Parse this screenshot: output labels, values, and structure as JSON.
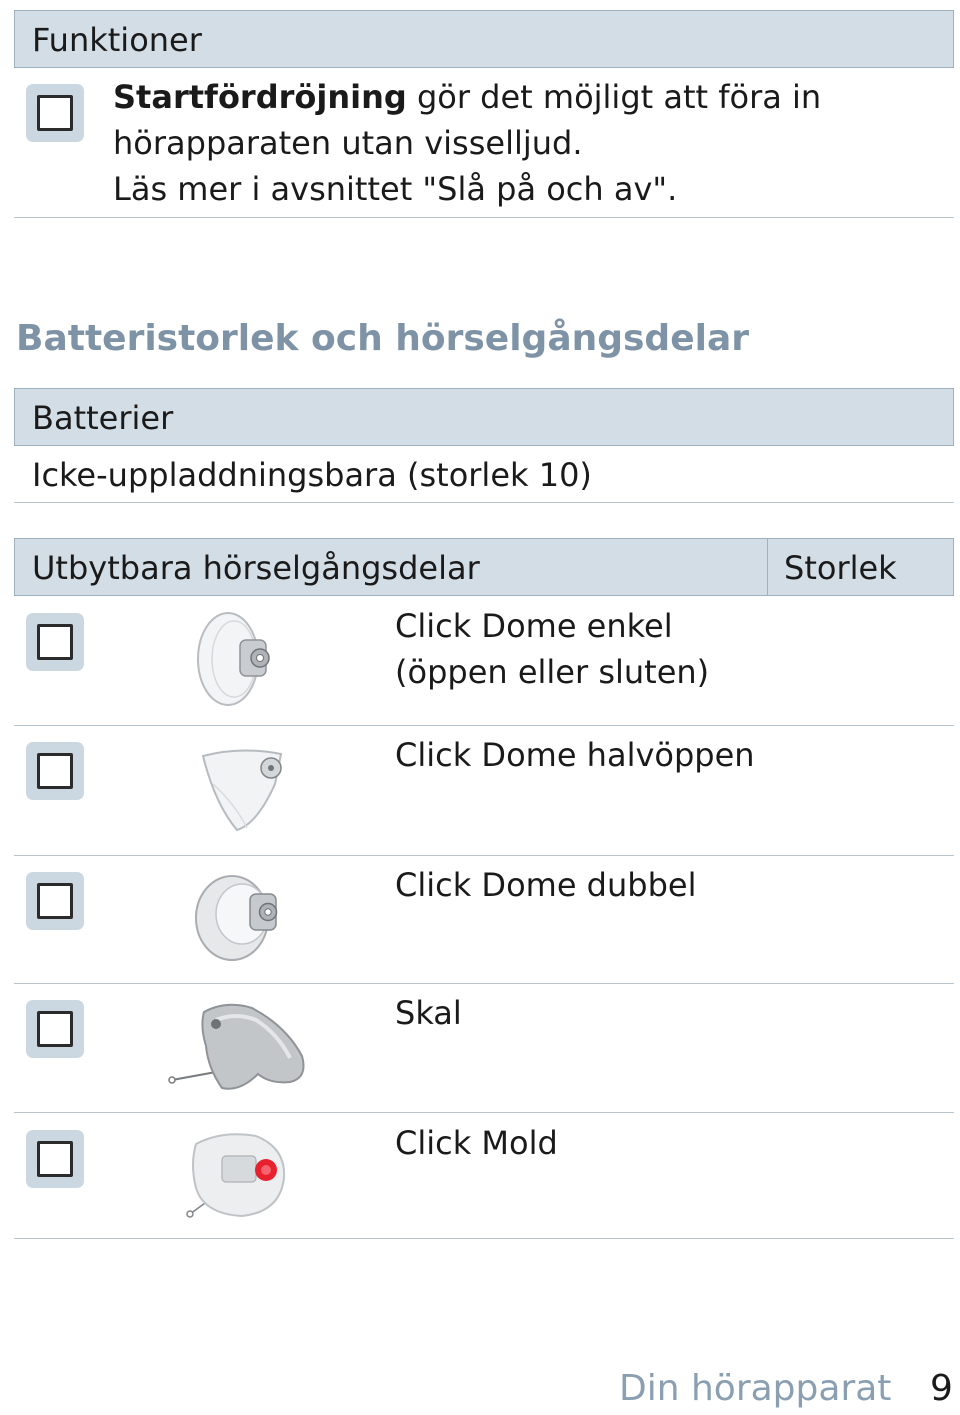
{
  "functions": {
    "header": "Funktioner",
    "startup_delay": {
      "bold": "Startfördröjning",
      "line1_rest": " gör det möjligt att föra in",
      "line2": "hörapparaten utan visselljud.",
      "line3": "Läs mer i avsnittet \"Slå på och av\"."
    }
  },
  "battery_section": {
    "heading": "Batteristorlek och hörselgångsdelar",
    "header": "Batterier",
    "value": "Icke-uppladdningsbara (storlek 10)"
  },
  "parts_table": {
    "header_parts": "Utbytbara hörselgångsdelar",
    "header_size": "Storlek",
    "rows": [
      {
        "label_line1": "Click Dome enkel",
        "label_line2": "(öppen eller sluten)",
        "icon": "click-dome-single-icon"
      },
      {
        "label_line1": "Click Dome halvöppen",
        "icon": "click-dome-half-open-icon"
      },
      {
        "label_line1": "Click Dome dubbel",
        "icon": "click-dome-double-icon"
      },
      {
        "label_line1": "Skal",
        "icon": "shell-icon"
      },
      {
        "label_line1": "Click Mold",
        "icon": "click-mold-icon"
      }
    ]
  },
  "footer": {
    "section": "Din hörapparat",
    "page": "9"
  },
  "colors": {
    "header_band": "#d3dde6",
    "heading_text": "#7e93a5",
    "footer_text": "#8aa0b2",
    "checkbox_bg": "#ccd8e1",
    "mold_red": "#e8212f"
  }
}
